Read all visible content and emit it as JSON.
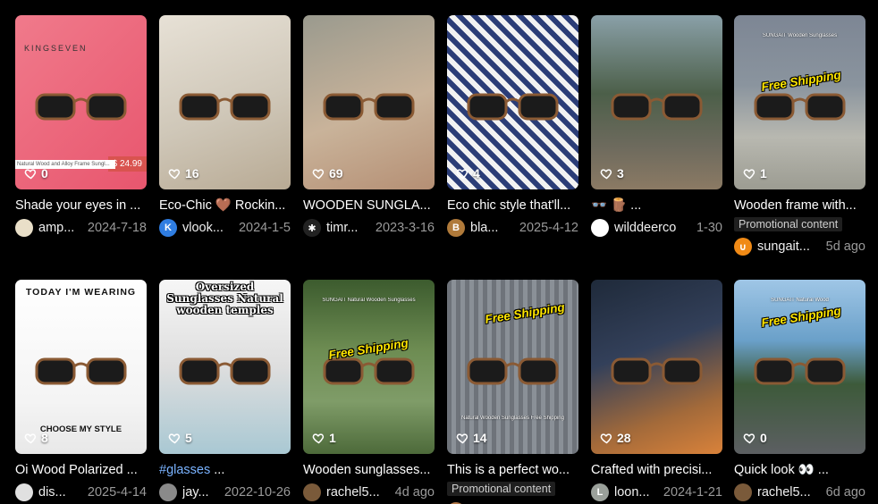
{
  "cards": [
    {
      "likes": "0",
      "title": "Shade your eyes in ...",
      "author": "amp...",
      "date": "2024-7-18",
      "avatar_color": "#e9dfc8",
      "avatar_glyph": "",
      "thumb_bg": "linear-gradient(135deg,#f07a8b,#e8566e)",
      "overlay": "KINGSEVEN",
      "price": "$ 24.99",
      "strip": "Natural Wood and Alloy Frame Sungl..."
    },
    {
      "likes": "16",
      "title": "Eco-Chic 🤎 Rockin...",
      "author": "vlook...",
      "date": "2024-1-5",
      "avatar_color": "#2f7de1",
      "avatar_glyph": "K",
      "thumb_bg": "linear-gradient(160deg,#e7e1d6,#cfc7b8 55%,#b8aa94)"
    },
    {
      "likes": "69",
      "title": "WOODEN SUNGLA...",
      "author": "timr...",
      "date": "2023-3-16",
      "avatar_color": "#222",
      "avatar_glyph": "✱",
      "thumb_bg": "linear-gradient(160deg,#9a9a8e,#c9b39a 55%,#b58f74)"
    },
    {
      "likes": "4",
      "title": "Eco chic style that'll...",
      "author": "bla...",
      "date": "2025-4-12",
      "avatar_color": "#b07a3a",
      "avatar_glyph": "B",
      "thumb_bg": "repeating-linear-gradient(45deg,#2b3d77 0 6px,#f2f2f2 6px 12px)"
    },
    {
      "likes": "3",
      "title": "👓 🪵 ...",
      "author": "wilddeerco",
      "date": "1-30",
      "avatar_color": "#ffffff",
      "avatar_glyph": "",
      "thumb_bg": "linear-gradient(180deg,#8aa0a8,#4c5f49 45%,#6d6a5d 75%,#8b7a64)"
    },
    {
      "likes": "1",
      "title": "Wooden frame with...",
      "promo": "Promotional content",
      "author": "sungait...",
      "date": "5d ago",
      "avatar_color": "#f08a16",
      "avatar_glyph": "∪",
      "thumb_bg": "linear-gradient(180deg,#7d8694,#8a949e 40%,#b8b8b0 70%,#9c9c92)",
      "free": "Free Shipping",
      "subcap": "SUNGAIT Wooden Sunglasses"
    },
    {
      "likes": "8",
      "title": "Oi Wood Polarized ...",
      "author": "dis...",
      "date": "2025-4-14",
      "avatar_color": "#e0e0e0",
      "avatar_glyph": "",
      "thumb_bg": "linear-gradient(180deg,#ffffff,#f4f4f4 70%,#e8e8e8)",
      "overlay": "TODAY I'M WEARING",
      "overlay2": "CHOOSE MY STYLE"
    },
    {
      "likes": "5",
      "title_tag": "#glasses",
      "title": " ...",
      "author": "jay...",
      "date": "2022-10-26",
      "avatar_color": "#8a8a8a",
      "avatar_glyph": "",
      "thumb_bg": "linear-gradient(180deg,#f6f6f6,#dedede 50%,#a9c8d3)",
      "overlay": "Oversized Sunglasses Natural wooden temples"
    },
    {
      "likes": "1",
      "title": "Wooden sunglasses...",
      "author": "rachel5...",
      "date": "4d ago",
      "avatar_color": "#7a5a3a",
      "avatar_glyph": "",
      "thumb_bg": "linear-gradient(180deg,#3c5b2e,#6d8c52 40%,#7f9c68 70%,#4d6a3a)",
      "free": "Free Shipping",
      "subcap": "SUNGAIT Natural Wooden Sunglasses"
    },
    {
      "likes": "14",
      "title": "This is a perfect wo...",
      "promo": "Promotional content",
      "author": "",
      "date": "",
      "avatar_color": "#b57a4a",
      "avatar_glyph": "",
      "thumb_bg": "repeating-linear-gradient(90deg,#6e737a 0 5px,#8a9097 5px 10px)",
      "free": "Free Shipping",
      "subcap": "Natural Wooden Sunglasses Free Shipping"
    },
    {
      "likes": "28",
      "title": "Crafted with precisi...",
      "author": "loon...",
      "date": "2024-1-21",
      "avatar_color": "#9aa09a",
      "avatar_glyph": "L",
      "thumb_bg": "linear-gradient(160deg,#1f2a3a,#33405a 40%,#a36a3a 75%,#d9823a)"
    },
    {
      "likes": "0",
      "title": "Quick look 👀 ...",
      "author": "rachel5...",
      "date": "6d ago",
      "avatar_color": "#7a5a3a",
      "avatar_glyph": "",
      "thumb_bg": "linear-gradient(180deg,#9fc6e6,#6aa0c9 35%,#3d5a3a 60%,#5c5f62)",
      "free": "Free Shipping",
      "subcap": "SUNGAIT Natural Wood"
    }
  ],
  "icons": {
    "like": "heart-outline-icon"
  }
}
